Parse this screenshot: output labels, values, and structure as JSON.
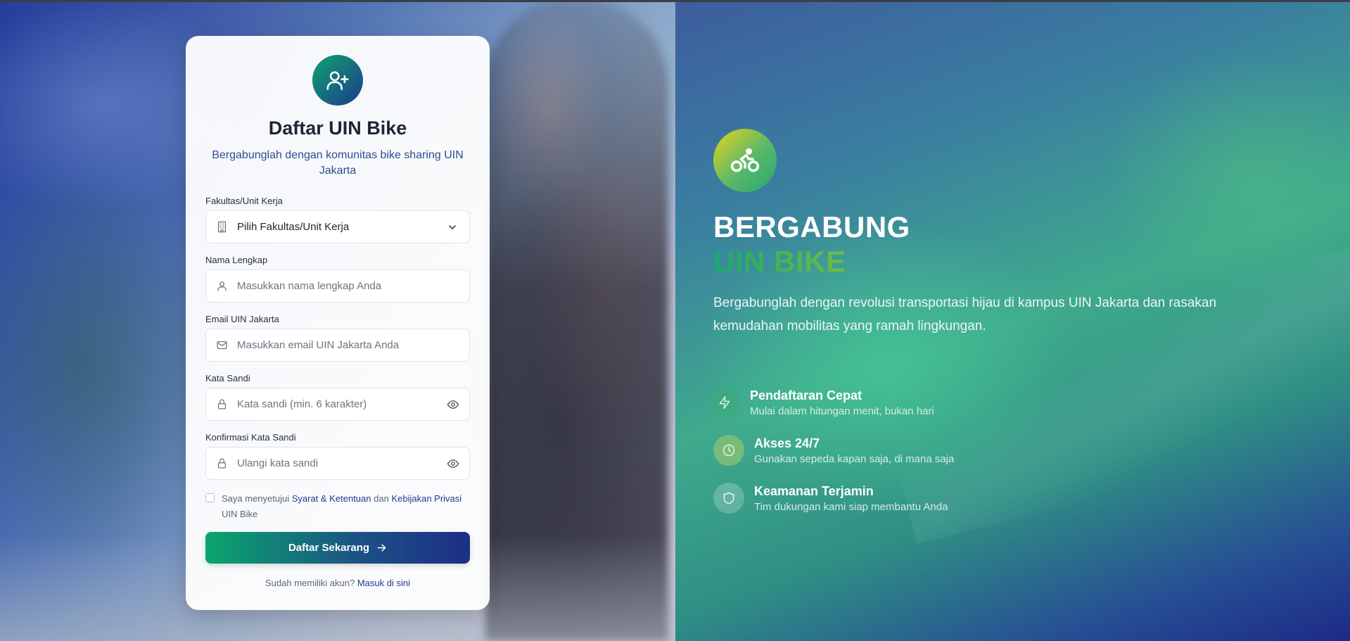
{
  "register_card": {
    "title": "Daftar UIN Bike",
    "subtitle": "Bergabunglah dengan komunitas bike sharing UIN Jakarta",
    "fields": {
      "faculty": {
        "label": "Fakultas/Unit Kerja",
        "value": "Pilih Fakultas/Unit Kerja"
      },
      "full_name": {
        "label": "Nama Lengkap",
        "placeholder": "Masukkan nama lengkap Anda"
      },
      "email": {
        "label": "Email UIN Jakarta",
        "placeholder": "Masukkan email UIN Jakarta Anda"
      },
      "password": {
        "label": "Kata Sandi",
        "placeholder": "Kata sandi (min. 6 karakter)"
      },
      "confirm_password": {
        "label": "Konfirmasi Kata Sandi",
        "placeholder": "Ulangi kata sandi"
      }
    },
    "terms": {
      "prefix": "Saya menyetujui",
      "terms_link": "Syarat & Ketentuan",
      "and": "dan",
      "privacy_link": "Kebijakan Privasi",
      "suffix": "UIN Bike"
    },
    "submit_label": "Daftar Sekarang",
    "login_prompt": "Sudah memiliki akun?",
    "login_link": "Masuk di sini"
  },
  "hero": {
    "title_line1": "BERGABUNG",
    "title_line2": "UIN BIKE",
    "description": "Bergabunglah dengan revolusi transportasi hijau di kampus UIN Jakarta dan rasakan kemudahan mobilitas yang ramah lingkungan.",
    "features": [
      {
        "icon": "lightning-icon",
        "title": "Pendaftaran Cepat",
        "subtitle": "Mulai dalam hitungan menit, bukan hari"
      },
      {
        "icon": "clock-icon",
        "title": "Akses 24/7",
        "subtitle": "Gunakan sepeda kapan saja, di mana saja"
      },
      {
        "icon": "shield-icon",
        "title": "Keamanan Terjamin",
        "subtitle": "Tim dukungan kami siap membantu Anda"
      }
    ]
  },
  "colors": {
    "brand_green": "#0aa66d",
    "brand_navy": "#1d2f86",
    "accent_yellow": "#e6d21c",
    "link_blue": "#1f3a8a"
  }
}
